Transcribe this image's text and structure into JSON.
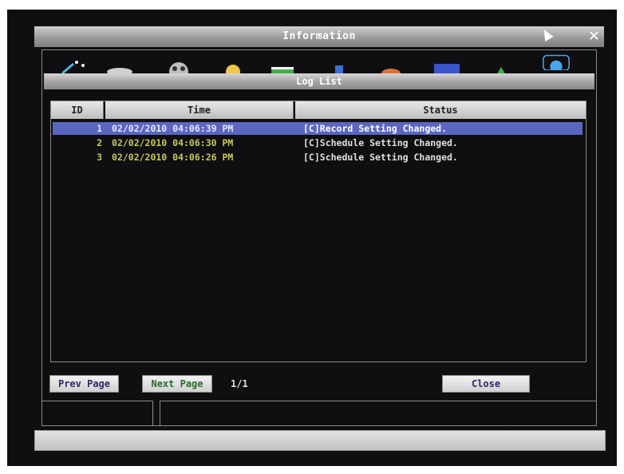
{
  "window": {
    "title": "Information",
    "close_glyph": "✕"
  },
  "icon_toolbar": {
    "icons": [
      {
        "name": "wand-icon",
        "color": "#4fb3e0"
      },
      {
        "name": "eye-icon",
        "color": "#cfcfcf"
      },
      {
        "name": "film-reel-icon",
        "color": "#bdbdbd"
      },
      {
        "name": "bulb-icon",
        "color": "#f0c64a"
      },
      {
        "name": "spreadsheet-icon",
        "color": "#3fae4a"
      },
      {
        "name": "document-icon",
        "color": "#3f6fd0"
      },
      {
        "name": "hdd-icon",
        "color": "#e0703a"
      },
      {
        "name": "monitor-icon",
        "color": "#3a55c8"
      },
      {
        "name": "network-icon",
        "color": "#3fae4a"
      },
      {
        "name": "info-globe-icon",
        "color": "#4aa6e8"
      }
    ]
  },
  "dialog": {
    "title": "Log List",
    "columns": [
      "ID",
      "Time",
      "Status"
    ],
    "rows": [
      {
        "id": "1",
        "time": "02/02/2010 04:06:39 PM",
        "status": "[C]Record Setting Changed.",
        "selected": true
      },
      {
        "id": "2",
        "time": "02/02/2010 04:06:30 PM",
        "status": "[C]Schedule Setting Changed.",
        "selected": false
      },
      {
        "id": "3",
        "time": "02/02/2010 04:06:26 PM",
        "status": "[C]Schedule Setting Changed.",
        "selected": false
      }
    ],
    "prev_label": "Prev Page",
    "next_label": "Next Page",
    "page_indicator": "1/1",
    "close_label": "Close"
  },
  "colors": {
    "selection": "#5a66c0",
    "row_text": "#c8c85a",
    "status_text": "#e0e0e0"
  }
}
